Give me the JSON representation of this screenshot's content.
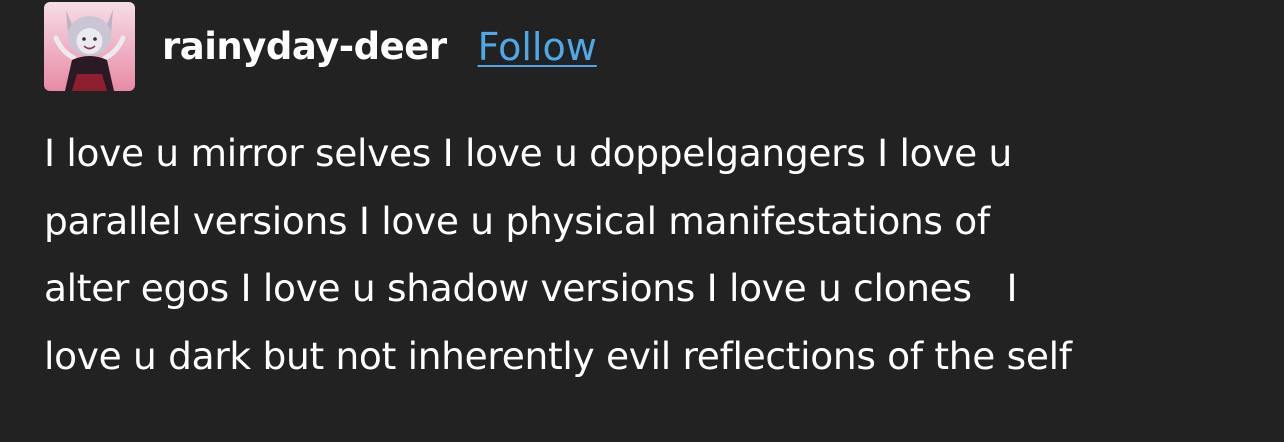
{
  "post": {
    "author": {
      "username": "rainyday-deer",
      "follow_label": "Follow",
      "avatar": "deer-character-avatar-image"
    },
    "content_lines": [
      "I love u mirror selves I love u doppelgangers I love u",
      "parallel versions I love u physical manifestations of",
      "alter egos I love u shadow versions I love u clones   I",
      "love u dark but not inherently evil reflections of the self"
    ]
  },
  "colors": {
    "background": "#222222",
    "text": "#ffffff",
    "link": "#4fa9e8"
  }
}
